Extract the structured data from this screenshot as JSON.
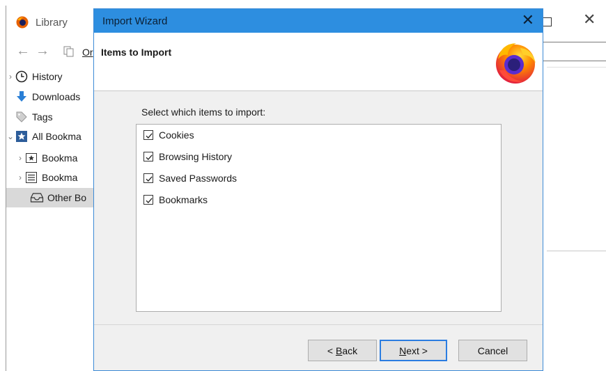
{
  "library": {
    "title": "Library",
    "organize_label": "Or",
    "tree": [
      {
        "label": "History",
        "twisty": ">",
        "icon": "clock-icon"
      },
      {
        "label": "Downloads",
        "twisty": "",
        "icon": "download-arrow-icon"
      },
      {
        "label": "Tags",
        "twisty": "",
        "icon": "tag-icon"
      },
      {
        "label": "All Bookma",
        "twisty": "v",
        "icon": "bookmarks-star-icon"
      },
      {
        "label": "Bookma",
        "twisty": ">",
        "icon": "bookmark-toolbar-icon"
      },
      {
        "label": "Bookma",
        "twisty": ">",
        "icon": "bookmark-menu-icon"
      },
      {
        "label": "Other Bo",
        "twisty": "",
        "icon": "other-bookmarks-tray-icon",
        "selected": true
      }
    ]
  },
  "dialog": {
    "title": "Import Wizard",
    "close_glyph": "✕",
    "heading": "Items to Import",
    "instruction": "Select which items to import:",
    "items": [
      {
        "label": "Cookies",
        "checked": true
      },
      {
        "label": "Browsing History",
        "checked": true
      },
      {
        "label": "Saved Passwords",
        "checked": true
      },
      {
        "label": "Bookmarks",
        "checked": true
      }
    ],
    "buttons": {
      "back_prefix": "< ",
      "back_accel": "B",
      "back_rest": "ack",
      "next_accel": "N",
      "next_rest": "ext >",
      "cancel": "Cancel"
    }
  },
  "colors": {
    "dialog_titlebar": "#2d8ee0",
    "default_button_border": "#2b7de1",
    "selection": "#d9d9d9"
  }
}
